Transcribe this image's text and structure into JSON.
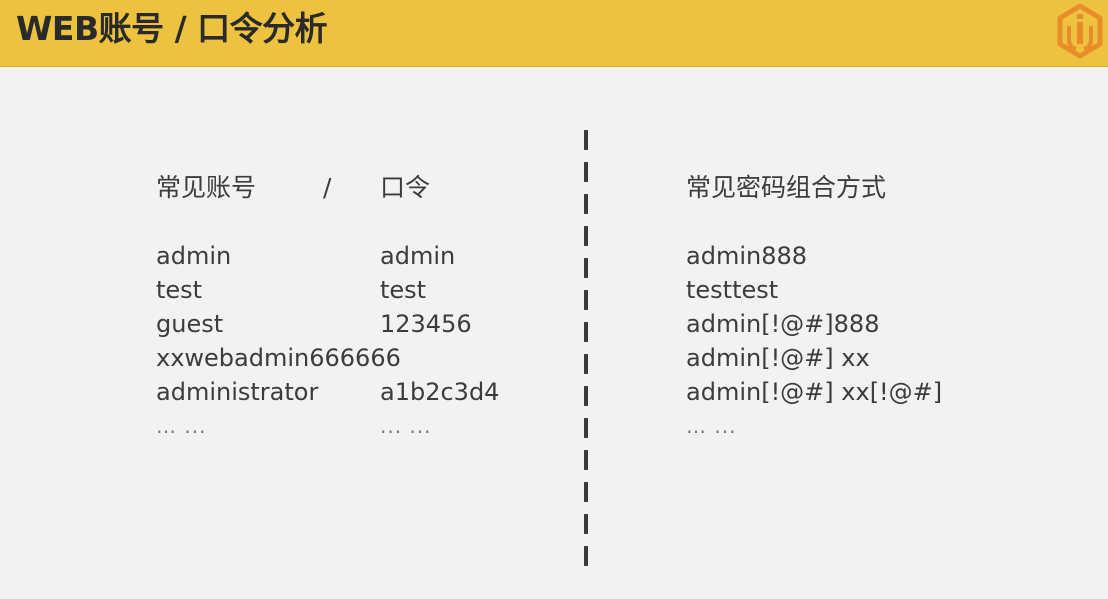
{
  "header": {
    "title": "WEB账号 / 口令分析",
    "logo_icon": "shield-logo-icon",
    "background_color": "#ecc23f",
    "logo_color": "#e98d2a"
  },
  "left": {
    "heading_account": "常见账号",
    "heading_sep": "/",
    "heading_password": "口令",
    "accounts": [
      "admin",
      "test",
      "guest",
      "xxwebadmin666666",
      "administrator",
      "… ..."
    ],
    "passwords": [
      "admin",
      "test",
      "123456",
      "",
      "a1b2c3d4",
      "... ..."
    ]
  },
  "right": {
    "heading": "常见密码组合方式",
    "items": [
      "admin888",
      "testtest",
      "admin[!@#]888",
      "admin[!@#] xx",
      "admin[!@#] xx[!@#]",
      "… ..."
    ]
  }
}
